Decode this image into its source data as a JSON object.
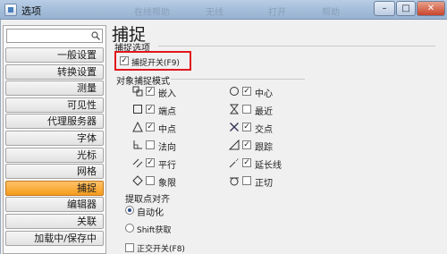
{
  "window": {
    "title": "选项",
    "ghost_texts": [
      "在线帮助",
      "无线",
      "打开",
      "帮助"
    ]
  },
  "sidebar": {
    "search_value": "",
    "items": [
      {
        "label": "一般设置",
        "selected": false
      },
      {
        "label": "转换设置",
        "selected": false
      },
      {
        "label": "测量",
        "selected": false
      },
      {
        "label": "可见性",
        "selected": false
      },
      {
        "label": "代理服务器",
        "selected": false
      },
      {
        "label": "字体",
        "selected": false
      },
      {
        "label": "光标",
        "selected": false
      },
      {
        "label": "网格",
        "selected": false
      },
      {
        "label": "捕捉",
        "selected": true
      },
      {
        "label": "编辑器",
        "selected": false
      },
      {
        "label": "关联",
        "selected": false
      },
      {
        "label": "加载中/保存中",
        "selected": false
      }
    ]
  },
  "content": {
    "title": "捕捉",
    "snap_options_label": "捕捉选项",
    "snap_toggle": {
      "label": "捕捉开关",
      "hotkey": "(F9)",
      "checked": true
    },
    "object_snap_label": "对象捕捉模式",
    "modes": [
      {
        "label": "嵌入",
        "checked": true,
        "icon": "insert-icon"
      },
      {
        "label": "中心",
        "checked": true,
        "icon": "center-icon"
      },
      {
        "label": "端点",
        "checked": true,
        "icon": "endpoint-icon"
      },
      {
        "label": "最近",
        "checked": false,
        "icon": "nearest-icon"
      },
      {
        "label": "中点",
        "checked": true,
        "icon": "midpoint-icon"
      },
      {
        "label": "交点",
        "checked": true,
        "icon": "intersection-icon"
      },
      {
        "label": "法向",
        "checked": false,
        "icon": "perpendicular-icon"
      },
      {
        "label": "跟踪",
        "checked": true,
        "icon": "tracking-icon"
      },
      {
        "label": "平行",
        "checked": true,
        "icon": "parallel-icon"
      },
      {
        "label": "延长线",
        "checked": true,
        "icon": "extension-icon"
      },
      {
        "label": "象限",
        "checked": false,
        "icon": "quadrant-icon"
      },
      {
        "label": "正切",
        "checked": false,
        "icon": "tangent-icon"
      }
    ],
    "alignment_label": "提取点对齐",
    "alignment_options": [
      {
        "label": "自动化",
        "checked": true
      },
      {
        "label": "Shift获取",
        "checked": false
      }
    ],
    "ortho_toggle": {
      "label": "正交开关",
      "hotkey": "(F8)",
      "checked": false
    }
  },
  "colors": {
    "selected_item": "#f49c1c",
    "highlight_border": "#e2171c",
    "titlebar": "#a3bcd9"
  }
}
